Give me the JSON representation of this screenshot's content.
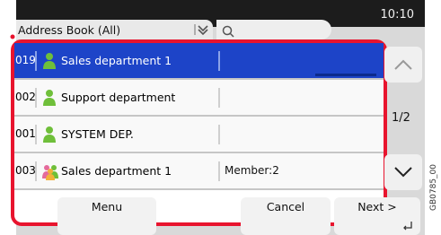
{
  "status_bar": {
    "time": "10:10"
  },
  "header": {
    "address_book_tab": "Address Book (All)"
  },
  "list": {
    "rows": [
      {
        "number": "019",
        "name": "Sales department 1",
        "member": "",
        "type": "contact",
        "selected": true
      },
      {
        "number": "002",
        "name": "Support department",
        "member": "",
        "type": "contact",
        "selected": false
      },
      {
        "number": "001",
        "name": "SYSTEM DEP.",
        "member": "",
        "type": "contact",
        "selected": false
      },
      {
        "number": "003",
        "name": "Sales department 1",
        "member": "Member:2",
        "type": "group",
        "selected": false
      }
    ]
  },
  "pager": {
    "page": "1/2"
  },
  "buttons": {
    "menu": "Menu",
    "cancel": "Cancel",
    "next": "Next >"
  },
  "figure_code": "GB0785_00",
  "colors": {
    "highlight": "#e8142e",
    "selected_row": "#1d44c8",
    "contact_icon": "#6fbf3a",
    "group_icon": "#e46a9c"
  }
}
